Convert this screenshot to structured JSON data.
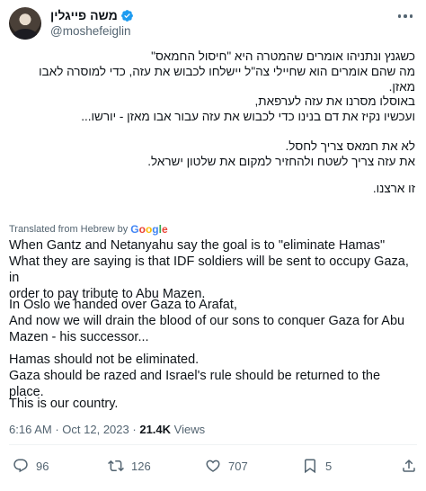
{
  "author": {
    "name": "משה פייגלין",
    "handle": "@moshefeiglin",
    "verified_color": "#1d9bf0"
  },
  "hebrew": {
    "p1": [
      "כשגנץ ונתניהו אומרים שהמטרה היא \"חיסול החמאס\"",
      "מה שהם אומרים הוא שחיילי צה\"ל יישלחו לכבוש את עזה, כדי למוסרה לאבו מאזן."
    ],
    "p2": [
      "באוסלו מסרנו את עזה לערפאת,",
      "ועכשיו נקיז את דם בנינו כדי לכבוש את עזה עבור אבו מאזן - יורשו..."
    ],
    "p3": [
      "לא את חמאס צריך לחסל.",
      "את עזה צריך לשטח ולהחזיר למקום את שלטון ישראל."
    ],
    "p4": [
      "זו ארצנו."
    ]
  },
  "translation": {
    "label": "Translated from Hebrew by",
    "provider": "Google"
  },
  "english": {
    "p1": [
      "When Gantz and Netanyahu say the goal is to \"eliminate Hamas\"",
      "What they are saying is that IDF soldiers will be sent to occupy Gaza, in",
      "order to pay tribute to Abu Mazen."
    ],
    "p2": [
      "In Oslo we handed over Gaza to Arafat,",
      "And now we will drain the blood of our sons to conquer Gaza for Abu",
      "Mazen - his successor..."
    ],
    "p3": [
      "Hamas should not be eliminated.",
      "Gaza should be razed and Israel's rule should be returned to the place."
    ],
    "p4": [
      "This is our country."
    ]
  },
  "meta": {
    "time": "6:16 AM",
    "date": "Oct 12, 2023",
    "separator": "·",
    "views_count": "21.4K",
    "views_label": "Views"
  },
  "actions": {
    "replies": "96",
    "reposts": "126",
    "likes": "707",
    "bookmarks": "5"
  },
  "colors": {
    "text": "#0f1419",
    "secondary": "#536471",
    "divider": "#eff3f4"
  }
}
